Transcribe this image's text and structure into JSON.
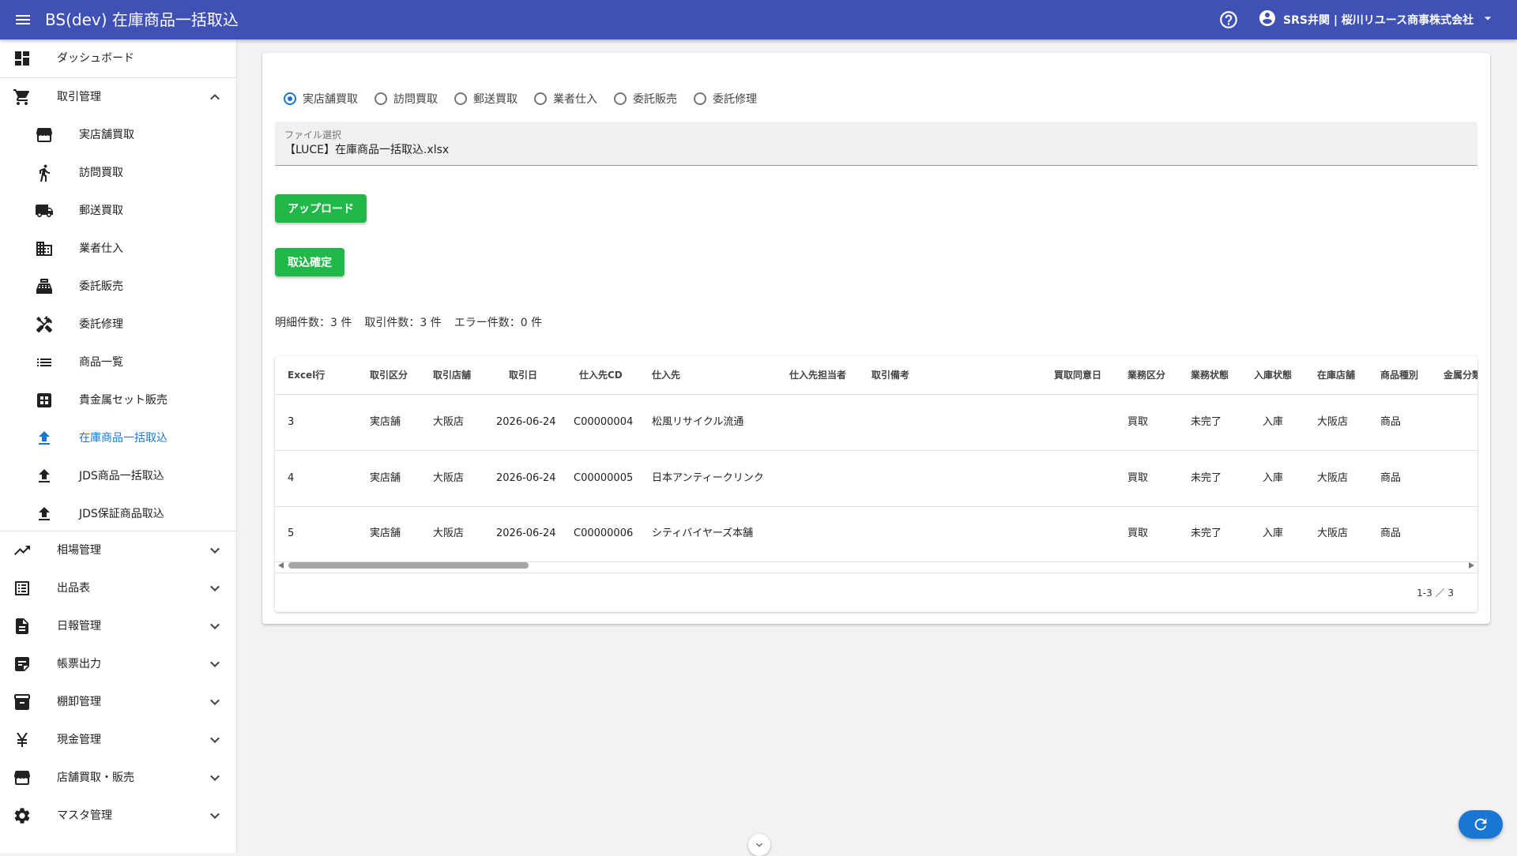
{
  "appbar": {
    "title": "BS(dev) 在庫商品一括取込",
    "user": "SRS井関 | 桜川リユース商事株式会社"
  },
  "sidebar": {
    "items": [
      {
        "label": "ダッシュボード",
        "icon": "dashboard-icon"
      },
      {
        "label": "取引管理",
        "icon": "cart-icon",
        "expanded": true
      },
      {
        "label": "実店舗買取",
        "icon": "store-icon"
      },
      {
        "label": "訪問買取",
        "icon": "walk-icon"
      },
      {
        "label": "郵送買取",
        "icon": "truck-icon"
      },
      {
        "label": "業者仕入",
        "icon": "building-icon"
      },
      {
        "label": "委託販売",
        "icon": "register-icon"
      },
      {
        "label": "委託修理",
        "icon": "tools-icon"
      },
      {
        "label": "商品一覧",
        "icon": "list-icon"
      },
      {
        "label": "貴金属セット販売",
        "icon": "grid-icon"
      },
      {
        "label": "在庫商品一括取込",
        "icon": "upload-icon",
        "active": true
      },
      {
        "label": "JDS商品一括取込",
        "icon": "upload-icon"
      },
      {
        "label": "JDS保証商品取込",
        "icon": "upload-icon"
      },
      {
        "label": "相場管理",
        "icon": "trend-icon"
      },
      {
        "label": "出品表",
        "icon": "list-alt-icon"
      },
      {
        "label": "日報管理",
        "icon": "document-icon"
      },
      {
        "label": "帳票出力",
        "icon": "note-icon"
      },
      {
        "label": "棚卸管理",
        "icon": "archive-icon"
      },
      {
        "label": "現金管理",
        "icon": "yen-icon"
      },
      {
        "label": "店舗買取・販売",
        "icon": "store-icon"
      },
      {
        "label": "マスタ管理",
        "icon": "gear-icon"
      }
    ]
  },
  "main": {
    "radios": [
      {
        "label": "実店舗買取",
        "checked": true
      },
      {
        "label": "訪問買取",
        "checked": false
      },
      {
        "label": "郵送買取",
        "checked": false
      },
      {
        "label": "業者仕入",
        "checked": false
      },
      {
        "label": "委託販売",
        "checked": false
      },
      {
        "label": "委託修理",
        "checked": false
      }
    ],
    "file": {
      "label": "ファイル選択",
      "value": "【LUCE】在庫商品一括取込.xlsx"
    },
    "upload_label": "アップロード",
    "confirm_label": "取込確定",
    "counts": {
      "detail": "明細件数：3 件",
      "transaction": "取引件数：3 件",
      "error": "エラー件数：0 件"
    },
    "table": {
      "columns": [
        "Excel行",
        "取引区分",
        "取引店舗",
        "取引日",
        "仕入先CD",
        "仕入先",
        "仕入先担当者",
        "取引備考",
        "買取同意日",
        "業務区分",
        "業務状態",
        "入庫状態",
        "在庫店舗",
        "商品種別",
        "金属分類"
      ],
      "rows": [
        [
          "3",
          "実店舗",
          "大阪店",
          "2026-06-24",
          "C00000004",
          "松風リサイクル流通",
          "",
          "",
          "",
          "買取",
          "未完了",
          "入庫",
          "大阪店",
          "商品",
          ""
        ],
        [
          "4",
          "実店舗",
          "大阪店",
          "2026-06-24",
          "C00000005",
          "日本アンティークリンク",
          "",
          "",
          "",
          "買取",
          "未完了",
          "入庫",
          "大阪店",
          "商品",
          ""
        ],
        [
          "5",
          "実店舗",
          "大阪店",
          "2026-06-24",
          "C00000006",
          "シティバイヤーズ本舗",
          "",
          "",
          "",
          "買取",
          "未完了",
          "入庫",
          "大阪店",
          "商品",
          ""
        ]
      ],
      "pagination": "1-3 ／ 3"
    }
  },
  "colors": {
    "appbar": "#3f51b5",
    "button": "#21b84a",
    "active_nav": "#1976d2",
    "radio_checked": "#1976d2",
    "fab": "#1976d2"
  }
}
